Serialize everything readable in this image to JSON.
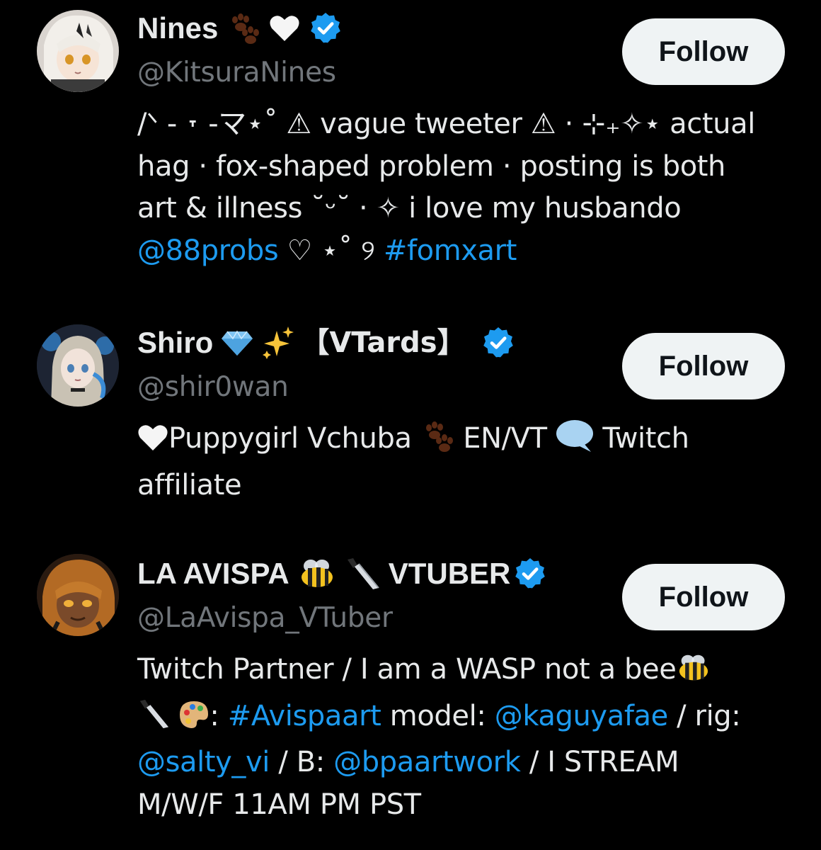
{
  "accounts": [
    {
      "name": "Nines",
      "name_emojis": [
        "paw-prints",
        "white-heart"
      ],
      "verified": true,
      "handle": "@KitsuraNines",
      "follow_label": "Follow",
      "bio_lines": [
        "/ᐠ - ˕ -マ⋆˚ ⚠ vague tweeter ⚠ · ⊹₊✧⋆ actual",
        "hag · fox-shaped problem · posting is both",
        "art & illness ˘ᵕ˘ · ✧ i love my husbando"
      ],
      "bio_mention": "@88probs",
      "bio_after_mention": " ♡ ⋆˚ ୨ ",
      "bio_hashtag": "#fomxart"
    },
    {
      "name": "Shiro",
      "name_emojis": [
        "gem",
        "sparkles"
      ],
      "name_suffix": "【VTards】",
      "verified": true,
      "handle": "@shir0wan",
      "follow_label": "Follow",
      "bio_line1_part1": "Puppygirl Vchuba ",
      "bio_line1_part2": " EN/VT ",
      "bio_line1_part3": " Twitch",
      "bio_line2": "affiliate"
    },
    {
      "name": "LA AVISPA",
      "name_emojis": [
        "bee",
        "knife"
      ],
      "name_suffix": "VTUBER",
      "verified": true,
      "handle": "@LaAvispa_VTuber",
      "follow_label": "Follow",
      "bio_line1": "Twitch Partner / I am a WASP not a bee",
      "bio_line2_sep": ": ",
      "bio_hashtag": "#Avispaart",
      "bio_model_label": " model: ",
      "bio_mention1": "@kaguyafae",
      "bio_rig_label": " / rig:",
      "bio_mention2": "@salty_vi",
      "bio_b_label": " / B: ",
      "bio_mention3": "@bpaartwork",
      "bio_stream": " / I STREAM",
      "bio_line4": "M/W/F 11AM PM PST"
    }
  ],
  "colors": {
    "background": "#000000",
    "text": "#e7e9ea",
    "secondary": "#71767b",
    "link": "#1d9bf0",
    "button_bg": "#eff3f4",
    "button_text": "#0f1419"
  }
}
